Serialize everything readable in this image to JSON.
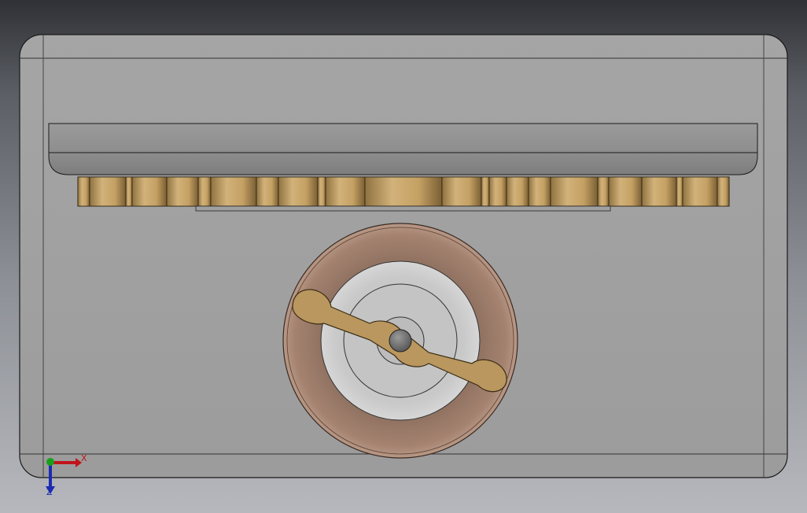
{
  "viewport": {
    "background": "#6f7278"
  },
  "model": {
    "housing_color": "#a1a1a1",
    "edge_color": "#1a1a1a",
    "gear_color": "#b9975e",
    "wheel_rim_color": "#a07e6c",
    "hub_color": "#c8c8c8",
    "handle_color": "#b9975e"
  },
  "triad": {
    "x_label": "X",
    "z_label": "Z",
    "x_color": "#c0151b",
    "y_color": "#19a119",
    "z_color": "#1c2ab3"
  }
}
